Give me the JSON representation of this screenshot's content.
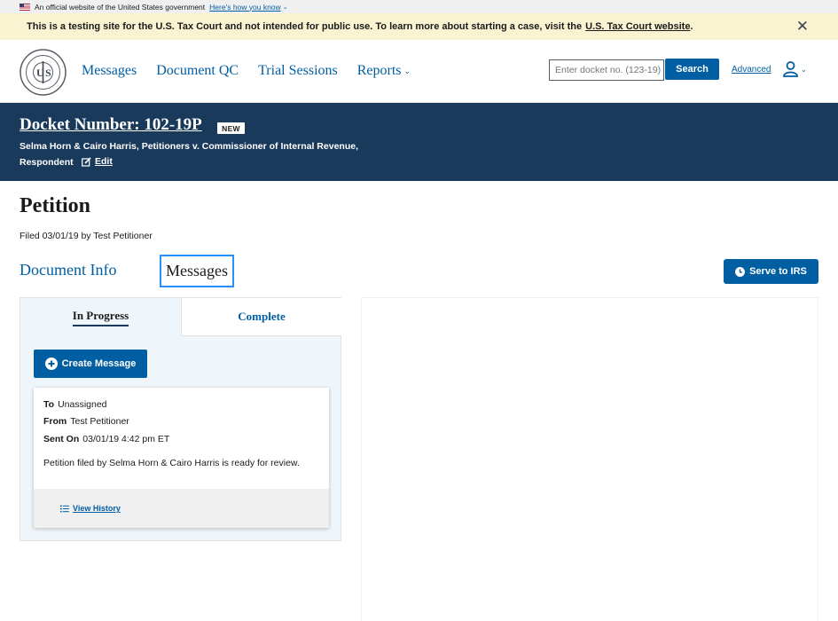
{
  "gov_banner": {
    "text": "An official website of the United States government",
    "link": "Here's how you know"
  },
  "test_banner": {
    "text": "This is a testing site for the U.S. Tax Court and not intended for public use. To learn more about starting a case, visit the",
    "link": "U.S. Tax Court website",
    "suffix": "."
  },
  "header": {
    "nav": [
      {
        "label": "Messages"
      },
      {
        "label": "Document QC"
      },
      {
        "label": "Trial Sessions"
      },
      {
        "label": "Reports"
      }
    ],
    "search": {
      "placeholder": "Enter docket no. (123-19)",
      "button": "Search",
      "advanced": "Advanced"
    }
  },
  "docket": {
    "title": "Docket Number: 102-19P",
    "badge": "NEW",
    "caption_line1": "Selma Horn & Cairo Harris, Petitioners v. Commissioner of Internal Revenue,",
    "caption_line2": "Respondent",
    "edit": "Edit"
  },
  "document": {
    "title": "Petition",
    "filed": "Filed 03/01/19 by Test Petitioner",
    "tabs": {
      "info": "Document Info",
      "messages": "Messages"
    },
    "serve_button": "Serve to IRS"
  },
  "messages_panel": {
    "tabs": {
      "in_progress": "In Progress",
      "complete": "Complete"
    },
    "create_button": "Create Message",
    "card": {
      "to_label": "To",
      "to_value": "Unassigned",
      "from_label": "From",
      "from_value": "Test Petitioner",
      "sent_label": "Sent On",
      "sent_value": "03/01/19 4:42 pm ET",
      "body": "Petition filed by Selma Horn & Cairo Harris is ready for review.",
      "history": "View History"
    }
  },
  "colors": {
    "primary": "#005ea2",
    "navy": "#1a3a5c",
    "banner": "#faf3d1",
    "panel": "#eff6fb"
  }
}
